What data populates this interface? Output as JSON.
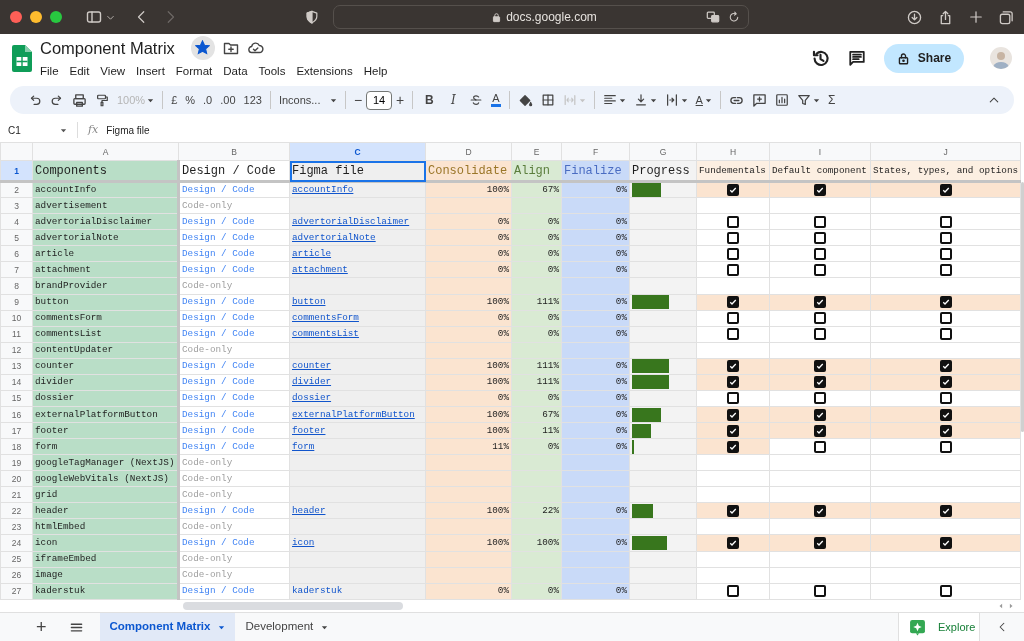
{
  "browser": {
    "url": "docs.google.com"
  },
  "document": {
    "title": "Component Matrix",
    "starred": true
  },
  "menu": [
    "File",
    "Edit",
    "View",
    "Insert",
    "Format",
    "Data",
    "Tools",
    "Extensions",
    "Help"
  ],
  "share_button": "Share",
  "toolbar": {
    "zoom": {
      "label": "100%",
      "disabled": true
    },
    "currency": "£",
    "percent": "%",
    "decrease_decimal": ".0",
    "increase_decimal": ".00",
    "number_format": "123",
    "font": "Incons...",
    "minus": "−",
    "font_size": "14",
    "plus": "+",
    "bold": "B",
    "italic": "I",
    "text_color": "A",
    "merge": {
      "disabled": true
    },
    "rotate": "A",
    "sum": "Σ"
  },
  "formula_bar": {
    "cell": "C1",
    "function_label": "fx",
    "content": "Figma file"
  },
  "columns": [
    {
      "letter": "A",
      "selected": false
    },
    {
      "letter": "B",
      "selected": false
    },
    {
      "letter": "C",
      "selected": true
    },
    {
      "letter": "D",
      "selected": false
    },
    {
      "letter": "E",
      "selected": false
    },
    {
      "letter": "F",
      "selected": false
    },
    {
      "letter": "G",
      "selected": false
    },
    {
      "letter": "H",
      "selected": false
    },
    {
      "letter": "I",
      "selected": false
    },
    {
      "letter": "J",
      "selected": false
    }
  ],
  "header_row": {
    "number": "1",
    "selected": true,
    "cells": [
      "Components",
      "Design / Code",
      "Figma file",
      "Consolidate",
      "Align",
      "Finalize",
      "Progress",
      "Fundementals",
      "Default component",
      "States, types, and options"
    ]
  },
  "rows": [
    {
      "number": "2",
      "component": "accountInfo",
      "kind": "design",
      "source": "Design / Code",
      "figma": "accountInfo",
      "linked": true,
      "consolidate": "100%",
      "align": "67%",
      "finalize": "0%",
      "level": 0.47,
      "checks": [
        true,
        true,
        true
      ]
    },
    {
      "number": "3",
      "component": "advertisement",
      "kind": "code",
      "source": "Code-only"
    },
    {
      "number": "4",
      "component": "advertorialDisclaimer",
      "kind": "design",
      "source": "Design / Code",
      "figma": "advertorialDisclaimer",
      "linked": true,
      "consolidate": "0%",
      "align": "0%",
      "finalize": "0%",
      "checks": [
        false,
        false,
        false
      ]
    },
    {
      "number": "5",
      "component": "advertorialNote",
      "kind": "design",
      "source": "Design / Code",
      "figma": "advertorialNote",
      "linked": true,
      "consolidate": "0%",
      "align": "0%",
      "finalize": "0%",
      "checks": [
        false,
        false,
        false
      ]
    },
    {
      "number": "6",
      "component": "article",
      "kind": "design",
      "source": "Design / Code",
      "figma": "article",
      "linked": true,
      "consolidate": "0%",
      "align": "0%",
      "finalize": "0%",
      "checks": [
        false,
        false,
        false
      ]
    },
    {
      "number": "7",
      "component": "attachment",
      "kind": "design",
      "source": "Design / Code",
      "figma": "attachment",
      "linked": true,
      "consolidate": "0%",
      "align": "0%",
      "finalize": "0%",
      "checks": [
        false,
        false,
        false
      ]
    },
    {
      "number": "8",
      "component": "brandProvider",
      "kind": "code",
      "source": "Code-only"
    },
    {
      "number": "9",
      "component": "button",
      "kind": "design",
      "source": "Design / Code",
      "figma": "button",
      "linked": true,
      "consolidate": "100%",
      "align": "111%",
      "finalize": "0%",
      "level": 0.6,
      "checks": [
        true,
        true,
        true
      ]
    },
    {
      "number": "10",
      "component": "commentsForm",
      "kind": "design",
      "source": "Design / Code",
      "figma": "commentsForm",
      "linked": true,
      "consolidate": "0%",
      "align": "0%",
      "finalize": "0%",
      "checks": [
        false,
        false,
        false
      ]
    },
    {
      "number": "11",
      "component": "commentsList",
      "kind": "design",
      "source": "Design / Code",
      "figma": "commentsList",
      "linked": true,
      "consolidate": "0%",
      "align": "0%",
      "finalize": "0%",
      "checks": [
        false,
        false,
        false
      ]
    },
    {
      "number": "12",
      "component": "contentUpdater",
      "kind": "code",
      "source": "Code-only"
    },
    {
      "number": "13",
      "component": "counter",
      "kind": "design",
      "source": "Design / Code",
      "figma": "counter",
      "linked": true,
      "consolidate": "100%",
      "align": "111%",
      "finalize": "0%",
      "level": 0.6,
      "checks": [
        true,
        true,
        true
      ]
    },
    {
      "number": "14",
      "component": "divider",
      "kind": "design",
      "source": "Design / Code",
      "figma": "divider",
      "linked": true,
      "consolidate": "100%",
      "align": "111%",
      "finalize": "0%",
      "level": 0.6,
      "checks": [
        true,
        true,
        true
      ]
    },
    {
      "number": "15",
      "component": "dossier",
      "kind": "design",
      "source": "Design / Code",
      "figma": "dossier",
      "linked": true,
      "consolidate": "0%",
      "align": "0%",
      "finalize": "0%",
      "checks": [
        false,
        false,
        false
      ]
    },
    {
      "number": "16",
      "component": "externalPlatformButton",
      "kind": "design",
      "source": "Design / Code",
      "figma": "externalPlatformButton",
      "linked": true,
      "consolidate": "100%",
      "align": "67%",
      "finalize": "0%",
      "level": 0.47,
      "checks": [
        true,
        true,
        true
      ]
    },
    {
      "number": "17",
      "component": "footer",
      "kind": "design",
      "source": "Design / Code",
      "figma": "footer",
      "linked": true,
      "consolidate": "100%",
      "align": "11%",
      "finalize": "0%",
      "level": 0.31,
      "checks": [
        true,
        true,
        true
      ]
    },
    {
      "number": "18",
      "component": "form",
      "kind": "design",
      "source": "Design / Code",
      "figma": "form",
      "linked": true,
      "consolidate": "11%",
      "align": "0%",
      "finalize": "0%",
      "level": 0.04,
      "checks": [
        true,
        false,
        false
      ]
    },
    {
      "number": "19",
      "component": "googleTagManager (NextJS)",
      "kind": "code",
      "source": "Code-only"
    },
    {
      "number": "20",
      "component": "googleWebVitals (NextJS)",
      "kind": "code",
      "source": "Code-only"
    },
    {
      "number": "21",
      "component": "grid",
      "kind": "code",
      "source": "Code-only"
    },
    {
      "number": "22",
      "component": "header",
      "kind": "design",
      "source": "Design / Code",
      "figma": "header",
      "linked": true,
      "consolidate": "100%",
      "align": "22%",
      "finalize": "0%",
      "level": 0.34,
      "checks": [
        true,
        true,
        true
      ]
    },
    {
      "number": "23",
      "component": "htmlEmbed",
      "kind": "code",
      "source": "Code-only"
    },
    {
      "number": "24",
      "component": "icon",
      "kind": "design",
      "source": "Design / Code",
      "figma": "icon",
      "linked": true,
      "consolidate": "100%",
      "align": "100%",
      "finalize": "0%",
      "level": 0.57,
      "checks": [
        true,
        true,
        true
      ]
    },
    {
      "number": "25",
      "component": "iframeEmbed",
      "kind": "code",
      "source": "Code-only"
    },
    {
      "number": "26",
      "component": "image",
      "kind": "code",
      "source": "Code-only"
    },
    {
      "number": "27",
      "component": "kaderstuk",
      "kind": "design",
      "source": "Design / Code",
      "figma": "kaderstuk",
      "linked": false,
      "consolidate": "0%",
      "align": "0%",
      "finalize": "0%",
      "checks": [
        false,
        false,
        false
      ]
    }
  ],
  "add_sheet": "+",
  "sheets": [
    {
      "name": "Component Matrix",
      "selected": true
    },
    {
      "name": "Development",
      "selected": false
    }
  ],
  "explore": "Explore"
}
